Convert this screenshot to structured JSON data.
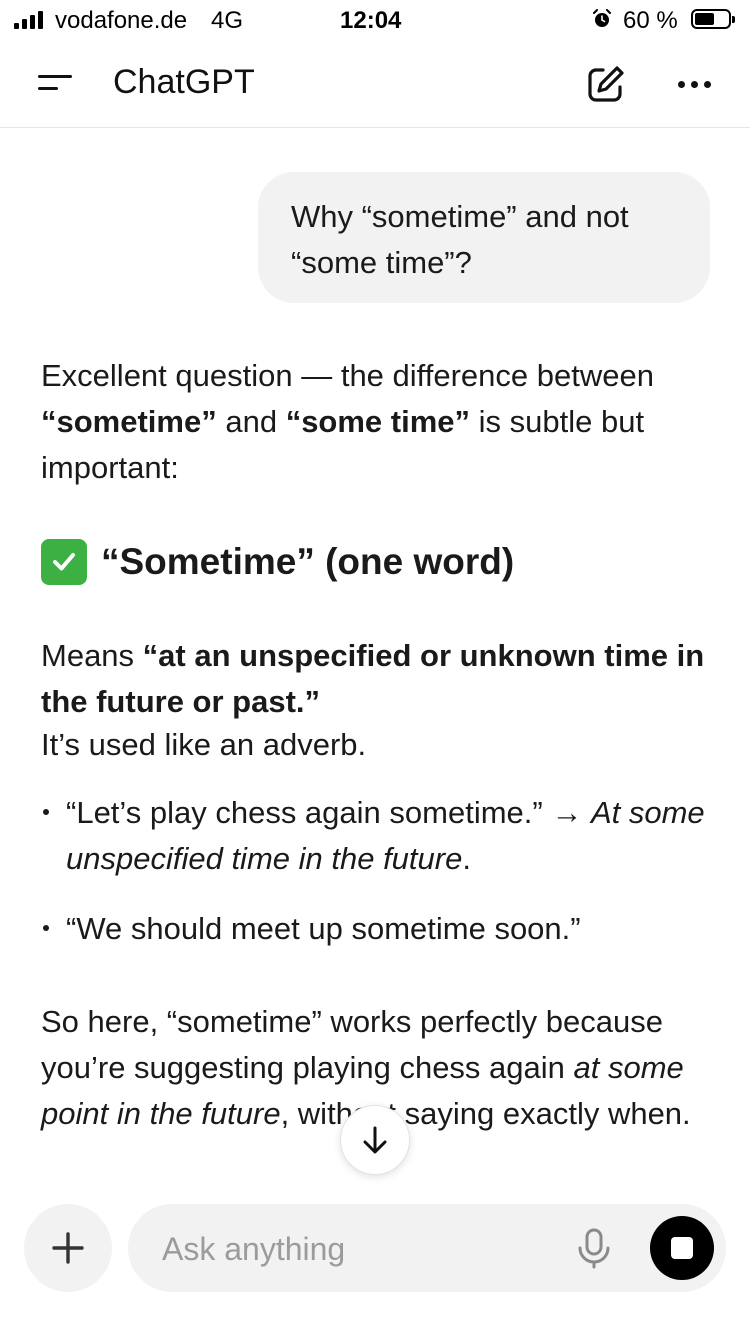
{
  "status_bar": {
    "carrier": "vodafone.de",
    "network": "4G",
    "time": "12:04",
    "battery": "60 %",
    "battery_level": 0.6,
    "icons": [
      "signal-icon",
      "alarm-icon",
      "battery-icon"
    ]
  },
  "header": {
    "title": "ChatGPT",
    "icons": [
      "menu-icon",
      "new-chat-icon",
      "more-icon"
    ]
  },
  "user_message": {
    "text": "Why “sometime” and not “some time”?"
  },
  "assistant": {
    "intro": {
      "lead": "Excellent question — the difference between ",
      "term1": "“sometime”",
      "mid": " and ",
      "term2": "“some time”",
      "tail": " is subtle but important:"
    },
    "heading": {
      "icon": "check-mark-icon",
      "text": "“Sometime” (one word)"
    },
    "meaning": {
      "lead": "Means ",
      "definition": "“at an unspecified or unknown time in the future or past.”"
    },
    "usage": "It’s used like an adverb.",
    "examples": [
      {
        "quote": "“Let’s play chess again sometime.” → ",
        "gloss": "At some unspecified time in the future",
        "end": "."
      },
      {
        "quote": "“We should meet up sometime soon.”"
      }
    ],
    "conclusion": {
      "part1": "So here, “sometime” works perfectly because you’re suggesting playing chess again ",
      "italic": "at some point in the future",
      "part2": ", without saying exactly when."
    }
  },
  "composer": {
    "placeholder": "Ask anything",
    "icons": [
      "plus-icon",
      "microphone-icon",
      "stop-icon"
    ]
  },
  "scroll_button": {
    "icon": "arrow-down-icon"
  },
  "colors": {
    "bubble": "#f2f2f2",
    "check": "#3cb043",
    "stop": "#000000"
  }
}
